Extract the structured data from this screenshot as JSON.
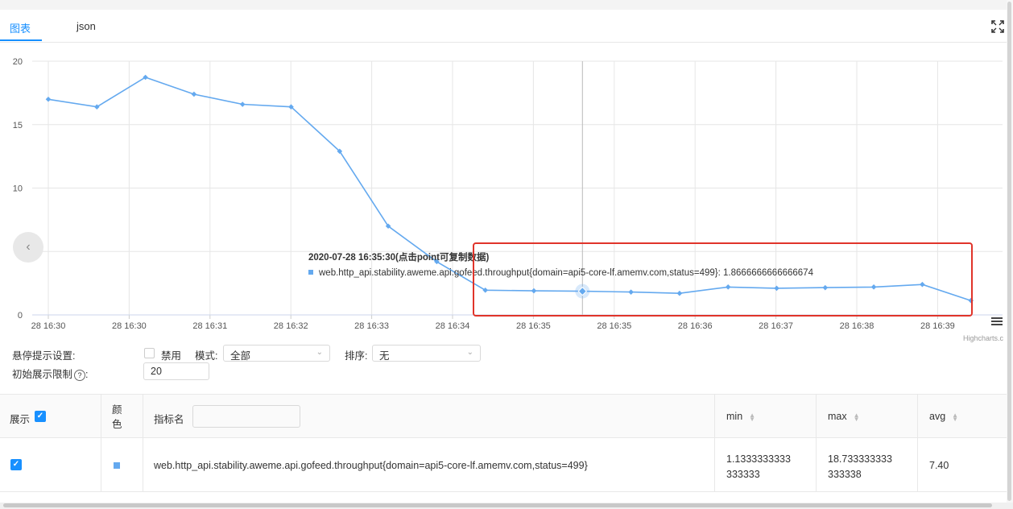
{
  "tabs": {
    "chart": "图表",
    "json": "json"
  },
  "chart_data": {
    "type": "line",
    "ylim": [
      0,
      20
    ],
    "yticks": [
      "0",
      "10",
      "15",
      "20"
    ],
    "xticks": [
      "28 16:30",
      "28 16:30",
      "28 16:31",
      "28 16:32",
      "28 16:33",
      "28 16:34",
      "28 16:35",
      "28 16:35",
      "28 16:36",
      "28 16:37",
      "28 16:38",
      "28 16:39"
    ],
    "values": [
      17.0,
      16.4,
      18.73,
      17.4,
      16.6,
      16.4,
      12.9,
      7.0,
      4.2,
      1.95,
      1.9,
      1.867,
      1.8,
      1.7,
      2.2,
      2.1,
      2.15,
      2.2,
      2.4,
      1.133
    ],
    "hovered_index": 11,
    "series_color": "#64a9ef",
    "grid": true,
    "credits": "Highcharts.c"
  },
  "tooltip": {
    "time": "2020-07-28 16:35:30(点击point可复制数据)",
    "series_text": "web.http_api.stability.aweme.api.gofeed.throughput{domain=api5-core-lf.amemv.com,status=499}: 1.8666666666666674"
  },
  "settings": {
    "hover_label": "悬停提示设置:",
    "disable_label": "禁用",
    "mode_label": "模式:",
    "mode_value": "全部",
    "sort_label": "排序:",
    "sort_value": "无",
    "limit_label": "初始展示限制",
    "limit_value": "20"
  },
  "table": {
    "headers": {
      "show": "展示",
      "color": "颜色",
      "name": "指标名",
      "min": "min",
      "max": "max",
      "avg": "avg"
    },
    "rows": [
      {
        "name": "web.http_api.stability.aweme.api.gofeed.throughput{domain=api5-core-lf.amemv.com,status=499}",
        "min_line1": "1.1333333333",
        "min_line2": "333333",
        "max_line1": "18.733333333",
        "max_line2": "333338",
        "avg": "7.40",
        "color": "#64a9ef"
      }
    ]
  }
}
